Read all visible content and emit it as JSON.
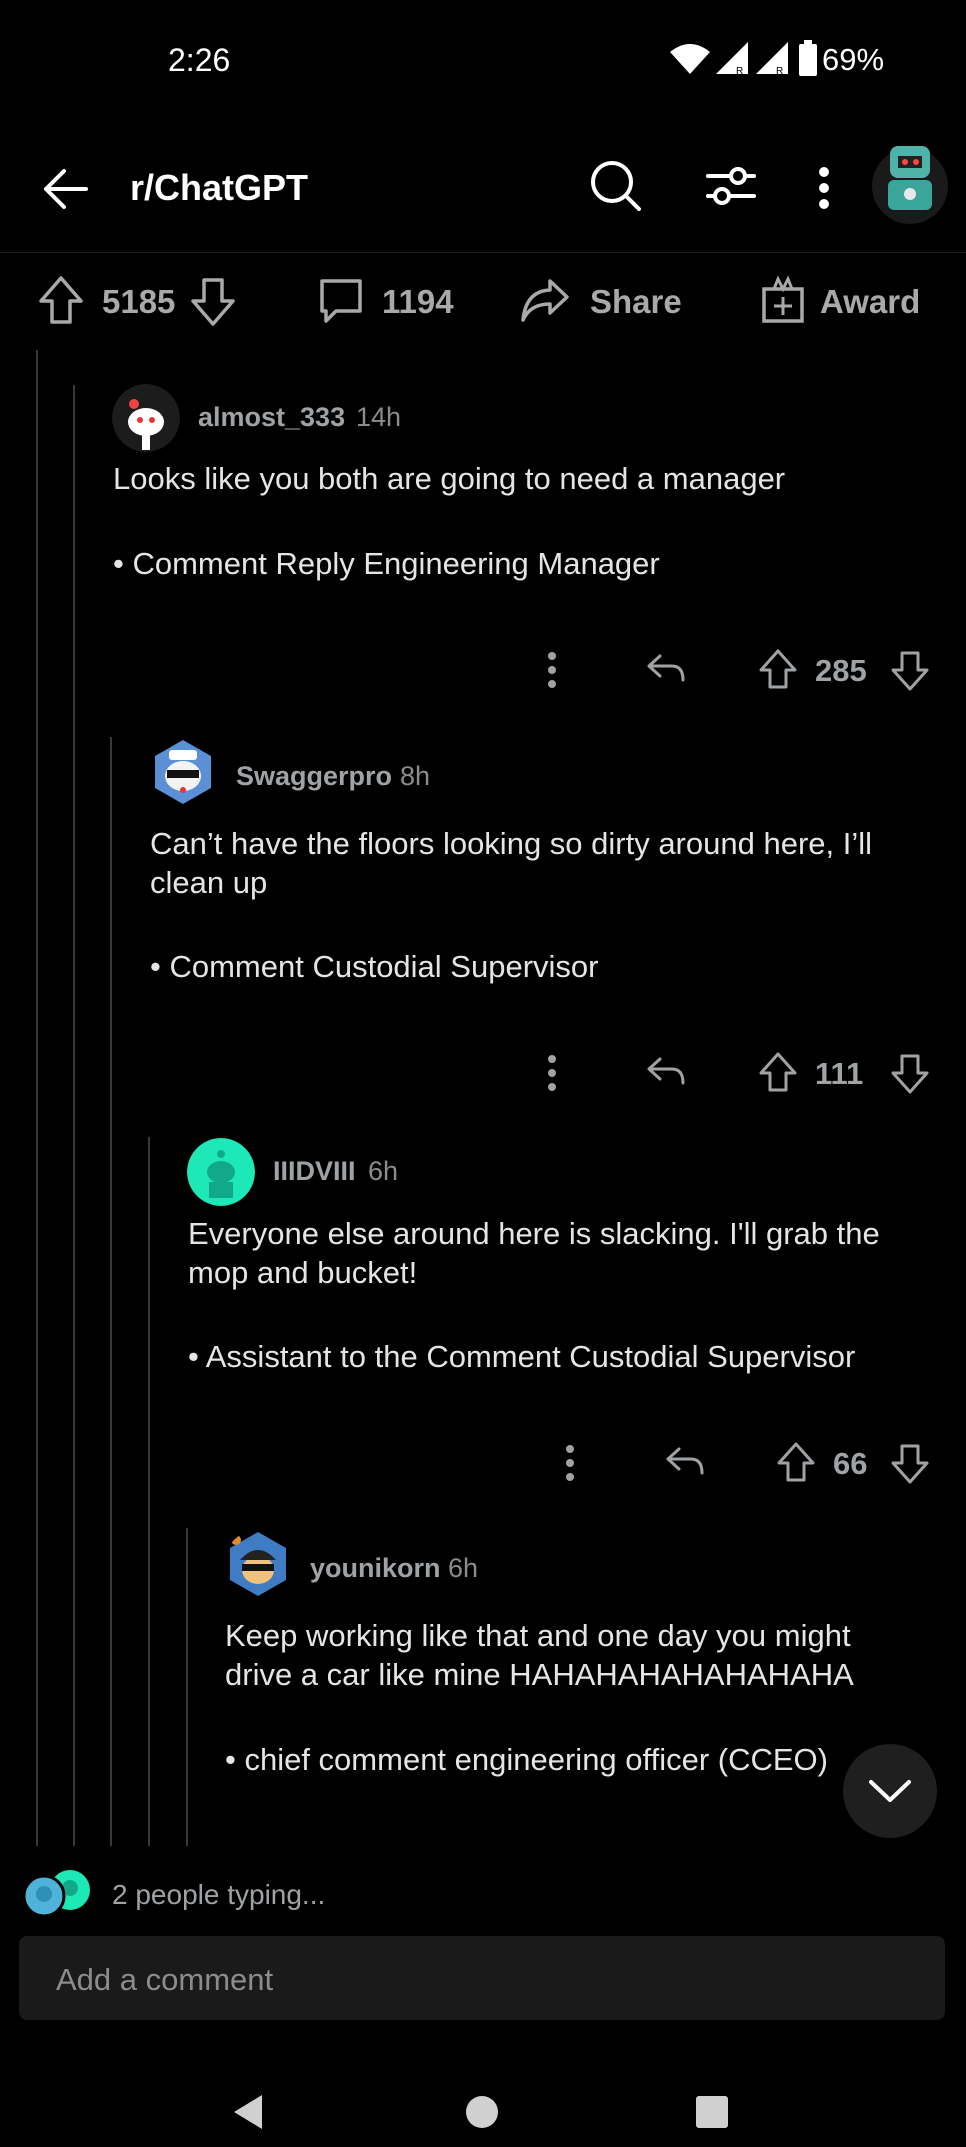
{
  "status_bar": {
    "time": "2:26",
    "battery": "69%"
  },
  "header": {
    "subreddit": "r/ChatGPT"
  },
  "post_actions": {
    "upvotes": "5185",
    "comments": "1194",
    "share_label": "Share",
    "award_label": "Award"
  },
  "comments": [
    {
      "user": "almost_333",
      "age": "14h",
      "text": "Looks like you both are going to need a manager",
      "flair": "• Comment Reply Engineering Manager",
      "score": "285"
    },
    {
      "user": "Swaggerpro",
      "age": "8h",
      "text": "Can’t have the floors looking so dirty around here, I’ll clean up",
      "flair": "• Comment Custodial Supervisor",
      "score": "111"
    },
    {
      "user": "IIIDVIII",
      "age": "6h",
      "text": "Everyone else around here is slacking. I'll grab the mop and bucket!",
      "flair": "• Assistant to the Comment Custodial Supervisor",
      "score": "66"
    },
    {
      "user": "younikorn",
      "age": "6h",
      "text": "Keep working like that and one day you might drive a car like mine HAHAHAHAHAHAHAHA",
      "flair": "• chief comment engineering officer (CCEO)"
    }
  ],
  "typing": {
    "text": "2 people typing..."
  },
  "composer": {
    "placeholder": "Add a comment"
  },
  "icons": {
    "back": "back-arrow-icon",
    "search": "search-icon",
    "filter": "filter-icon",
    "more": "more-vert-icon",
    "upvote": "upvote-icon",
    "downvote": "downvote-icon",
    "comment": "comment-icon",
    "share": "share-icon",
    "award": "award-icon",
    "reply": "reply-icon",
    "collapse": "chevron-down-icon"
  },
  "colors": {
    "background": "#000000",
    "text": "#d7dadc",
    "muted": "#a0a3a6",
    "accent_teal": "#1de9b6"
  }
}
